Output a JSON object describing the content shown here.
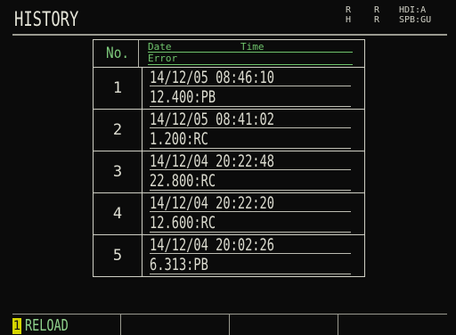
{
  "header": {
    "title": "HISTORY",
    "status_a": "R\nH",
    "status_b": "R\nR",
    "status_c": "HDI:A\nSPB:GU"
  },
  "table": {
    "col_no": "No.",
    "col_date": "Date",
    "col_time": "Time",
    "col_error": "Error",
    "records": [
      {
        "no": "1",
        "datetime": "14/12/05 08:46:10",
        "error": "12.400:PB"
      },
      {
        "no": "2",
        "datetime": "14/12/05 08:41:02",
        "error": "1.200:RC"
      },
      {
        "no": "3",
        "datetime": "14/12/04 20:22:48",
        "error": "22.800:RC"
      },
      {
        "no": "4",
        "datetime": "14/12/04 20:22:20",
        "error": "12.600:RC"
      },
      {
        "no": "5",
        "datetime": "14/12/04 20:02:26",
        "error": "6.313:PB"
      }
    ]
  },
  "function_keys": [
    {
      "num": "1",
      "label": "RELOAD"
    },
    {
      "num": "",
      "label": ""
    },
    {
      "num": "",
      "label": ""
    },
    {
      "num": "",
      "label": ""
    }
  ]
}
